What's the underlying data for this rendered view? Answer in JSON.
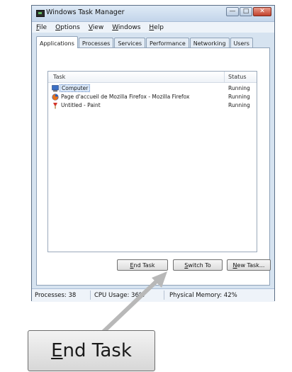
{
  "window": {
    "title": "Windows Task Manager",
    "controls": {
      "minimize": "—",
      "maximize": "□",
      "close": "✕"
    }
  },
  "menu": [
    {
      "label": "File",
      "accel": "F",
      "rest": "ile"
    },
    {
      "label": "Options",
      "accel": "O",
      "rest": "ptions"
    },
    {
      "label": "View",
      "accel": "V",
      "rest": "iew"
    },
    {
      "label": "Windows",
      "accel": "W",
      "rest": "indows"
    },
    {
      "label": "Help",
      "accel": "H",
      "rest": "elp"
    }
  ],
  "tabs": [
    "Applications",
    "Processes",
    "Services",
    "Performance",
    "Networking",
    "Users"
  ],
  "list": {
    "headers": {
      "task": "Task",
      "status": "Status"
    },
    "rows": [
      {
        "task": "Computer",
        "status": "Running",
        "icon": "computer-icon"
      },
      {
        "task": "Page d'accueil de Mozilla Firefox - Mozilla Firefox",
        "status": "Running",
        "icon": "firefox-icon"
      },
      {
        "task": "Untitled - Paint",
        "status": "Running",
        "icon": "paint-icon"
      }
    ]
  },
  "buttons": {
    "end_task": {
      "accel": "E",
      "rest": "nd Task"
    },
    "switch_to": {
      "accel": "S",
      "rest": "witch To"
    },
    "new_task": {
      "accel": "N",
      "rest": "ew Task..."
    }
  },
  "statusbar": {
    "processes": "Processes: 38",
    "cpu": "CPU Usage: 36%",
    "memory": "Physical Memory: 42%"
  },
  "zoom": {
    "accel": "E",
    "rest": "nd Task"
  },
  "colors": {
    "window_frame": "#d6e3f0",
    "selection": "#dbe9fa",
    "arrow": "#b8b8b8"
  }
}
